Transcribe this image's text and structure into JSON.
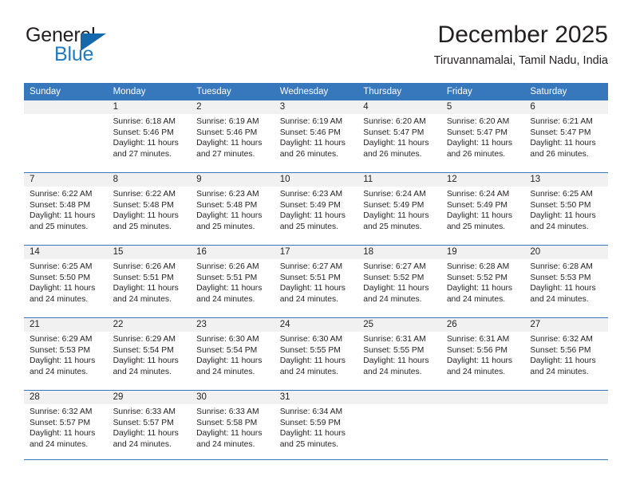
{
  "logo": {
    "word_top": "General",
    "word_bottom": "Blue",
    "accent_color": "#1668ad",
    "text_color": "#231f20"
  },
  "header": {
    "title": "December 2025",
    "location": "Tiruvannamalai, Tamil Nadu, India"
  },
  "theme": {
    "header_row_bg": "#3777bc",
    "daynum_bg": "#f1f1f1",
    "rule_color": "#3777bc",
    "text": "#231f20"
  },
  "weekday_headers": [
    "Sunday",
    "Monday",
    "Tuesday",
    "Wednesday",
    "Thursday",
    "Friday",
    "Saturday"
  ],
  "weeks": [
    [
      {
        "day": "",
        "lines": [
          "",
          "",
          "",
          ""
        ]
      },
      {
        "day": "1",
        "lines": [
          "Sunrise: 6:18 AM",
          "Sunset: 5:46 PM",
          "Daylight: 11 hours",
          "and 27 minutes."
        ]
      },
      {
        "day": "2",
        "lines": [
          "Sunrise: 6:19 AM",
          "Sunset: 5:46 PM",
          "Daylight: 11 hours",
          "and 27 minutes."
        ]
      },
      {
        "day": "3",
        "lines": [
          "Sunrise: 6:19 AM",
          "Sunset: 5:46 PM",
          "Daylight: 11 hours",
          "and 26 minutes."
        ]
      },
      {
        "day": "4",
        "lines": [
          "Sunrise: 6:20 AM",
          "Sunset: 5:47 PM",
          "Daylight: 11 hours",
          "and 26 minutes."
        ]
      },
      {
        "day": "5",
        "lines": [
          "Sunrise: 6:20 AM",
          "Sunset: 5:47 PM",
          "Daylight: 11 hours",
          "and 26 minutes."
        ]
      },
      {
        "day": "6",
        "lines": [
          "Sunrise: 6:21 AM",
          "Sunset: 5:47 PM",
          "Daylight: 11 hours",
          "and 26 minutes."
        ]
      }
    ],
    [
      {
        "day": "7",
        "lines": [
          "Sunrise: 6:22 AM",
          "Sunset: 5:48 PM",
          "Daylight: 11 hours",
          "and 25 minutes."
        ]
      },
      {
        "day": "8",
        "lines": [
          "Sunrise: 6:22 AM",
          "Sunset: 5:48 PM",
          "Daylight: 11 hours",
          "and 25 minutes."
        ]
      },
      {
        "day": "9",
        "lines": [
          "Sunrise: 6:23 AM",
          "Sunset: 5:48 PM",
          "Daylight: 11 hours",
          "and 25 minutes."
        ]
      },
      {
        "day": "10",
        "lines": [
          "Sunrise: 6:23 AM",
          "Sunset: 5:49 PM",
          "Daylight: 11 hours",
          "and 25 minutes."
        ]
      },
      {
        "day": "11",
        "lines": [
          "Sunrise: 6:24 AM",
          "Sunset: 5:49 PM",
          "Daylight: 11 hours",
          "and 25 minutes."
        ]
      },
      {
        "day": "12",
        "lines": [
          "Sunrise: 6:24 AM",
          "Sunset: 5:49 PM",
          "Daylight: 11 hours",
          "and 25 minutes."
        ]
      },
      {
        "day": "13",
        "lines": [
          "Sunrise: 6:25 AM",
          "Sunset: 5:50 PM",
          "Daylight: 11 hours",
          "and 24 minutes."
        ]
      }
    ],
    [
      {
        "day": "14",
        "lines": [
          "Sunrise: 6:25 AM",
          "Sunset: 5:50 PM",
          "Daylight: 11 hours",
          "and 24 minutes."
        ]
      },
      {
        "day": "15",
        "lines": [
          "Sunrise: 6:26 AM",
          "Sunset: 5:51 PM",
          "Daylight: 11 hours",
          "and 24 minutes."
        ]
      },
      {
        "day": "16",
        "lines": [
          "Sunrise: 6:26 AM",
          "Sunset: 5:51 PM",
          "Daylight: 11 hours",
          "and 24 minutes."
        ]
      },
      {
        "day": "17",
        "lines": [
          "Sunrise: 6:27 AM",
          "Sunset: 5:51 PM",
          "Daylight: 11 hours",
          "and 24 minutes."
        ]
      },
      {
        "day": "18",
        "lines": [
          "Sunrise: 6:27 AM",
          "Sunset: 5:52 PM",
          "Daylight: 11 hours",
          "and 24 minutes."
        ]
      },
      {
        "day": "19",
        "lines": [
          "Sunrise: 6:28 AM",
          "Sunset: 5:52 PM",
          "Daylight: 11 hours",
          "and 24 minutes."
        ]
      },
      {
        "day": "20",
        "lines": [
          "Sunrise: 6:28 AM",
          "Sunset: 5:53 PM",
          "Daylight: 11 hours",
          "and 24 minutes."
        ]
      }
    ],
    [
      {
        "day": "21",
        "lines": [
          "Sunrise: 6:29 AM",
          "Sunset: 5:53 PM",
          "Daylight: 11 hours",
          "and 24 minutes."
        ]
      },
      {
        "day": "22",
        "lines": [
          "Sunrise: 6:29 AM",
          "Sunset: 5:54 PM",
          "Daylight: 11 hours",
          "and 24 minutes."
        ]
      },
      {
        "day": "23",
        "lines": [
          "Sunrise: 6:30 AM",
          "Sunset: 5:54 PM",
          "Daylight: 11 hours",
          "and 24 minutes."
        ]
      },
      {
        "day": "24",
        "lines": [
          "Sunrise: 6:30 AM",
          "Sunset: 5:55 PM",
          "Daylight: 11 hours",
          "and 24 minutes."
        ]
      },
      {
        "day": "25",
        "lines": [
          "Sunrise: 6:31 AM",
          "Sunset: 5:55 PM",
          "Daylight: 11 hours",
          "and 24 minutes."
        ]
      },
      {
        "day": "26",
        "lines": [
          "Sunrise: 6:31 AM",
          "Sunset: 5:56 PM",
          "Daylight: 11 hours",
          "and 24 minutes."
        ]
      },
      {
        "day": "27",
        "lines": [
          "Sunrise: 6:32 AM",
          "Sunset: 5:56 PM",
          "Daylight: 11 hours",
          "and 24 minutes."
        ]
      }
    ],
    [
      {
        "day": "28",
        "lines": [
          "Sunrise: 6:32 AM",
          "Sunset: 5:57 PM",
          "Daylight: 11 hours",
          "and 24 minutes."
        ]
      },
      {
        "day": "29",
        "lines": [
          "Sunrise: 6:33 AM",
          "Sunset: 5:57 PM",
          "Daylight: 11 hours",
          "and 24 minutes."
        ]
      },
      {
        "day": "30",
        "lines": [
          "Sunrise: 6:33 AM",
          "Sunset: 5:58 PM",
          "Daylight: 11 hours",
          "and 24 minutes."
        ]
      },
      {
        "day": "31",
        "lines": [
          "Sunrise: 6:34 AM",
          "Sunset: 5:59 PM",
          "Daylight: 11 hours",
          "and 25 minutes."
        ]
      },
      {
        "day": "",
        "lines": [
          "",
          "",
          "",
          ""
        ]
      },
      {
        "day": "",
        "lines": [
          "",
          "",
          "",
          ""
        ]
      },
      {
        "day": "",
        "lines": [
          "",
          "",
          "",
          ""
        ]
      }
    ]
  ]
}
